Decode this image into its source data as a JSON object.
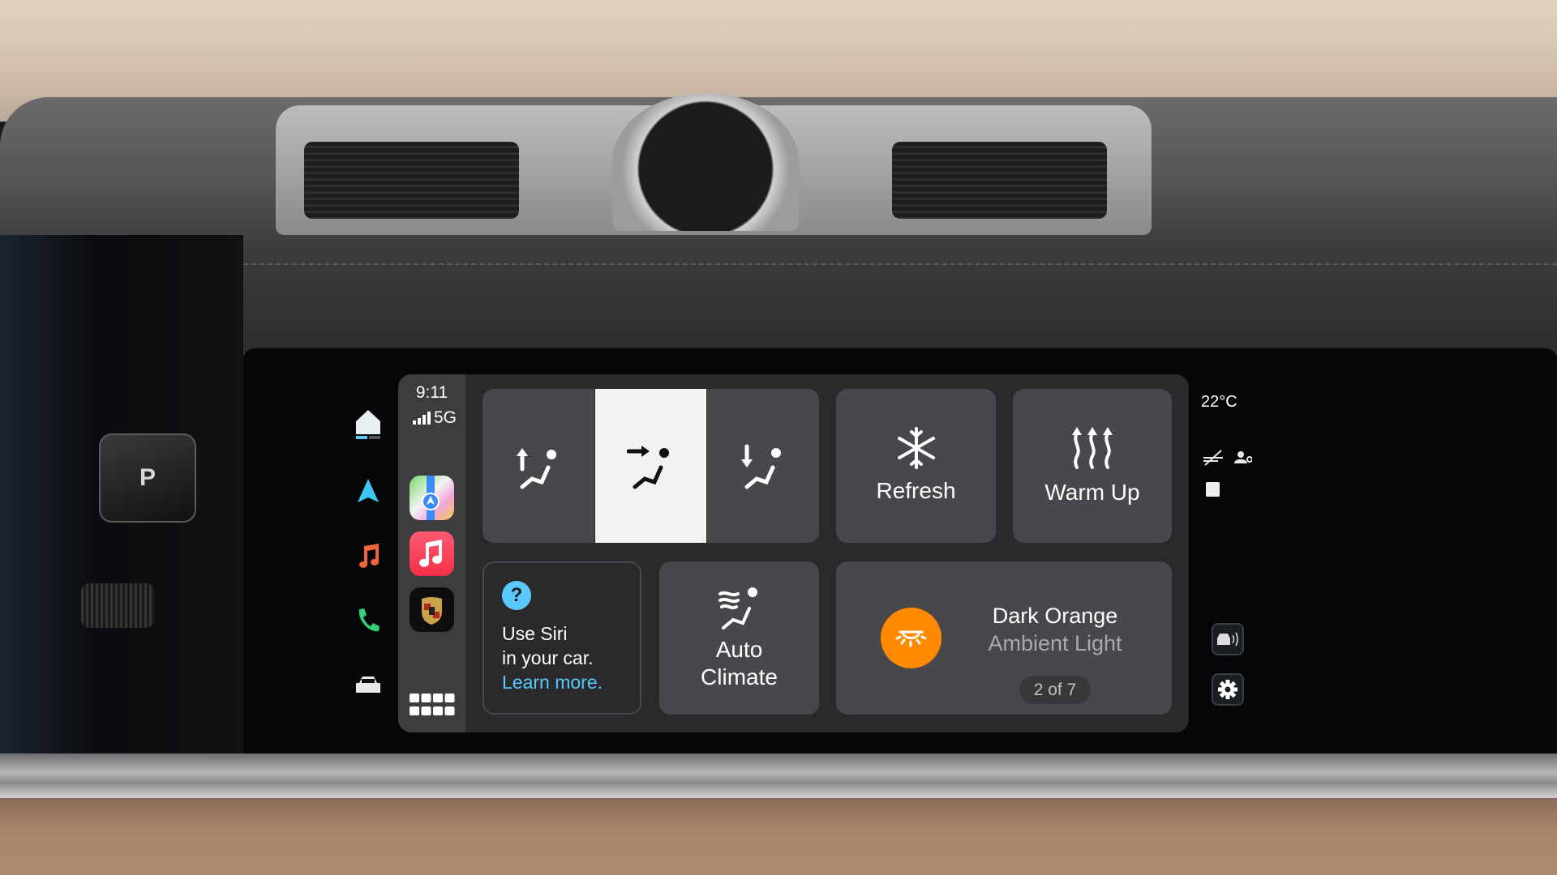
{
  "status": {
    "time": "9:11",
    "network": "5G"
  },
  "car_sidebar": {
    "items": [
      "home-icon",
      "navigation-icon",
      "music-icon",
      "phone-icon",
      "car-icon"
    ]
  },
  "dock": {
    "apps": [
      {
        "name": "Maps",
        "icon": "maps-icon"
      },
      {
        "name": "Music",
        "icon": "music-app-icon"
      },
      {
        "name": "Porsche",
        "icon": "porsche-crest-icon"
      }
    ],
    "app_grid_icon": "app-grid-icon"
  },
  "airflow": {
    "options": [
      "airflow-up-icon",
      "airflow-center-icon",
      "airflow-down-icon"
    ],
    "selected_index": 1
  },
  "tiles": {
    "refresh": {
      "label": "Refresh",
      "icon": "snowflake-icon"
    },
    "warm_up": {
      "label": "Warm Up",
      "icon": "heat-waves-icon"
    },
    "siri": {
      "line1": "Use Siri",
      "line2": "in your car.",
      "link": "Learn more.",
      "icon": "question-icon"
    },
    "auto_climate": {
      "line1": "Auto",
      "line2": "Climate",
      "icon": "auto-climate-icon"
    },
    "ambient": {
      "title": "Dark Orange",
      "subtitle": "Ambient Light",
      "page": "2 of 7",
      "icon": "ambient-light-icon"
    }
  },
  "right_status": {
    "temperature": "22°C"
  },
  "colors": {
    "accent_orange": "#ff8a00",
    "link_blue": "#5ac8fa",
    "tile": "#48484c",
    "selected": "#f2f2f2"
  }
}
